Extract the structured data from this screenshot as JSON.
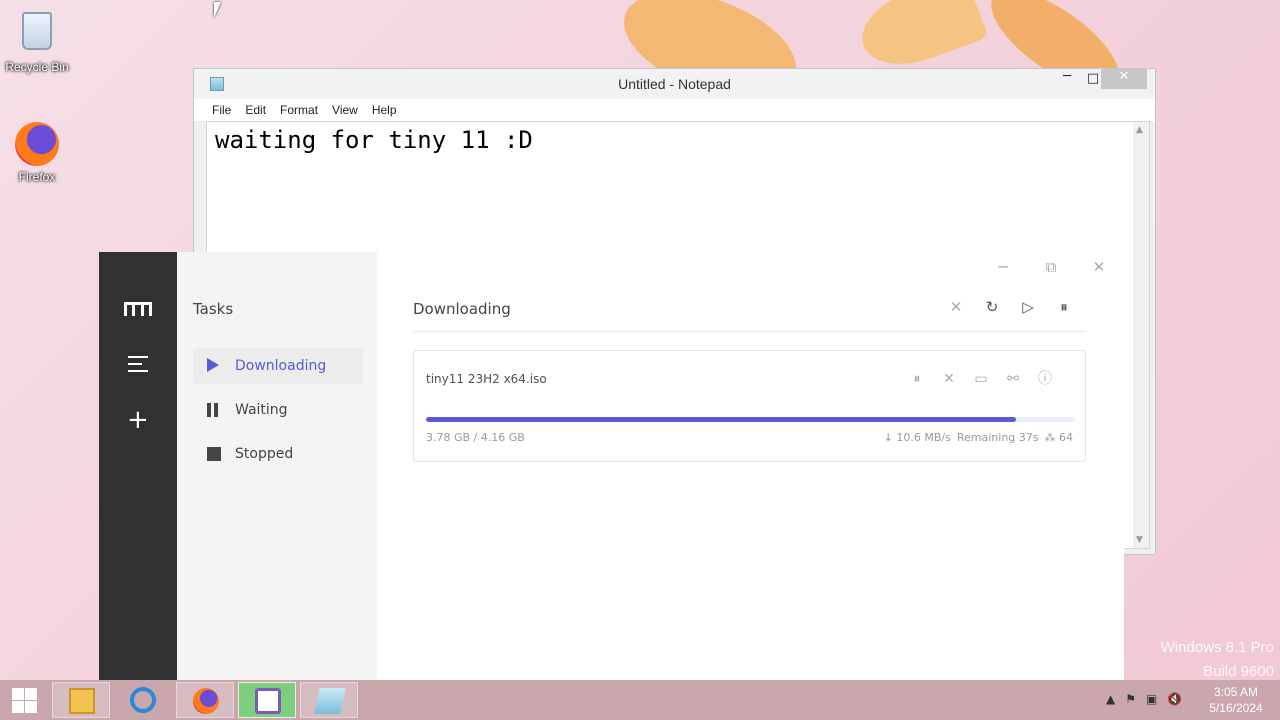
{
  "desktop": {
    "icons": [
      {
        "label": "Recycle Bin"
      },
      {
        "label": "Firefox"
      }
    ],
    "watermark": {
      "line1": "Windows 8.1 Pro",
      "line2": "Build 9600"
    }
  },
  "notepad": {
    "title": "Untitled - Notepad",
    "menu": [
      "File",
      "Edit",
      "Format",
      "View",
      "Help"
    ],
    "content": "waiting for tiny 11 :D",
    "controls": {
      "minimize": "─",
      "maximize": "□",
      "close": "✕"
    }
  },
  "motrix": {
    "sidebar": {
      "heading": "Tasks",
      "items": [
        {
          "label": "Downloading",
          "icon": "play-icon",
          "active": true
        },
        {
          "label": "Waiting",
          "icon": "pause-icon",
          "active": false
        },
        {
          "label": "Stopped",
          "icon": "stop-icon",
          "active": false
        }
      ]
    },
    "window_controls": {
      "minimize": "─",
      "maximize": "⧉",
      "close": "✕"
    },
    "main": {
      "title": "Downloading",
      "toolbar": {
        "delete": "✕",
        "refresh": "↻",
        "resume": "▷",
        "pause": "⏸"
      }
    },
    "task": {
      "name": "tiny11 23H2 x64.iso",
      "progress": 0.9087,
      "size": "3.78 GB / 4.16 GB",
      "speed": "↓ 10.6 MB/s",
      "remaining": "Remaining 37s",
      "connections": "⁂ 64",
      "actions": {
        "pause": "⏸",
        "delete": "✕",
        "folder": "▭",
        "link": "⚯",
        "info": "ⓘ"
      }
    },
    "accent": "#5b5bd6"
  },
  "taskbar": {
    "clock": {
      "time": "3:05 AM",
      "date": "5/16/2024"
    },
    "tray": {
      "arrow": "▲",
      "flag": "⚑",
      "network": "▣",
      "volume": "🔇"
    }
  }
}
